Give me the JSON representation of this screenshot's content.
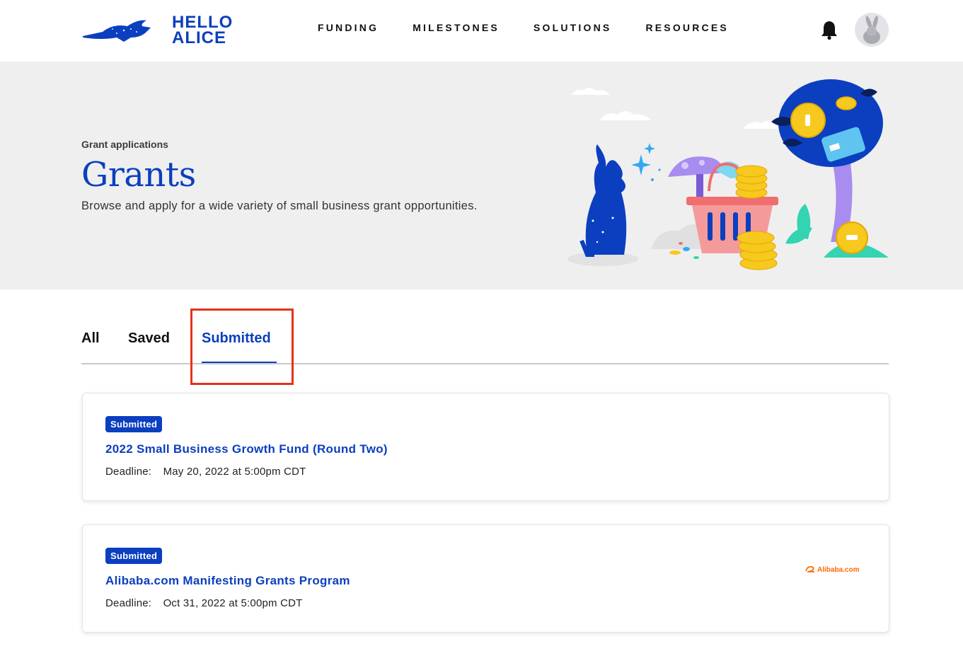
{
  "header": {
    "logo": {
      "line1": "HELLO",
      "line2": "ALICE"
    },
    "nav": [
      "FUNDING",
      "MILESTONES",
      "SOLUTIONS",
      "RESOURCES"
    ],
    "icons": {
      "notifications": "bell-icon",
      "profile": "rabbit-avatar"
    }
  },
  "hero": {
    "eyebrow": "Grant applications",
    "title": "Grants",
    "subtitle": "Browse and apply for a wide variety of small business grant opportunities."
  },
  "tabs": {
    "items": [
      "All",
      "Saved",
      "Submitted"
    ],
    "active": "Submitted"
  },
  "grants": [
    {
      "status": "Submitted",
      "title": "2022 Small Business Growth Fund (Round Two)",
      "deadline_label": "Deadline:",
      "deadline": "May 20, 2022 at 5:00pm CDT",
      "partner": ""
    },
    {
      "status": "Submitted",
      "title": "Alibaba.com Manifesting Grants Program",
      "deadline_label": "Deadline:",
      "deadline": "Oct 31, 2022 at 5:00pm CDT",
      "partner": "Alibaba.com"
    }
  ],
  "colors": {
    "brand_blue": "#0b3fbf",
    "highlight_red": "#e5321b",
    "hero_bg": "#efefef",
    "alibaba_orange": "#ff6a00"
  }
}
